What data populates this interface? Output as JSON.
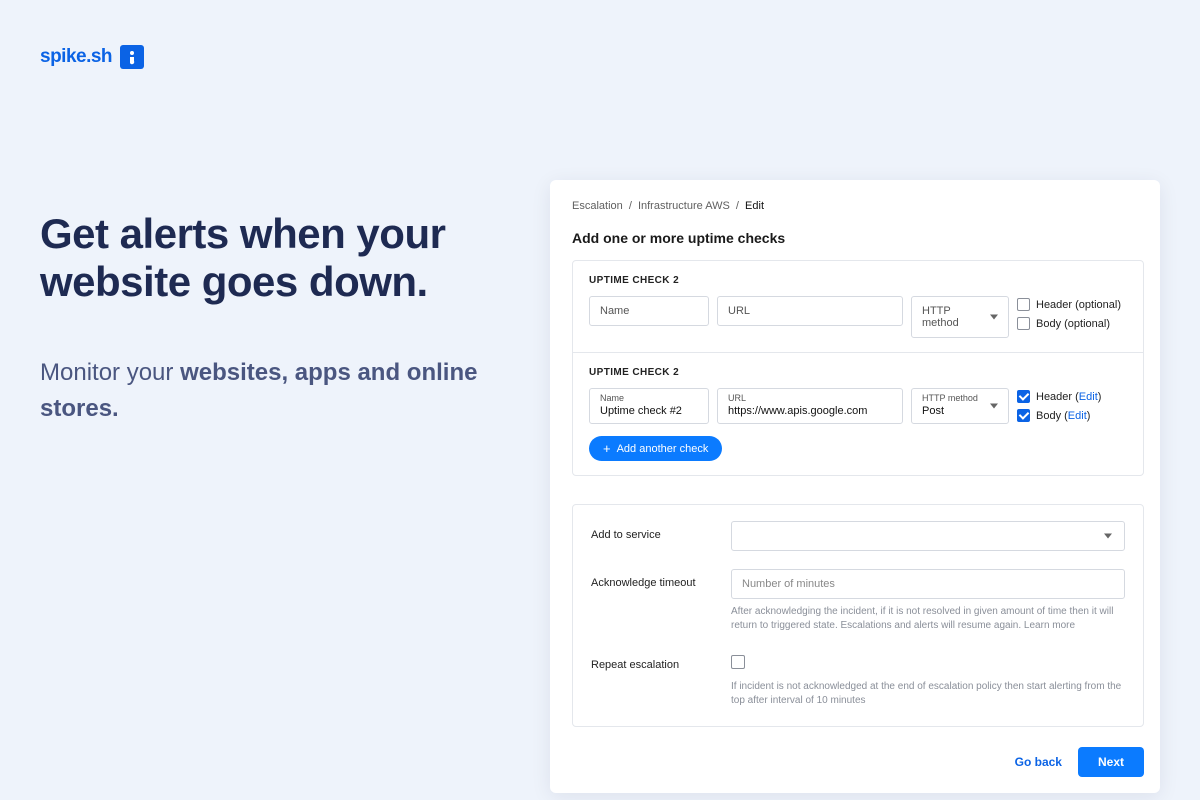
{
  "brand": {
    "name": "spike.sh"
  },
  "marketing": {
    "headline": "Get alerts when your website goes down.",
    "sub_prefix": "Monitor your ",
    "sub_bold": "websites, apps and online stores."
  },
  "breadcrumb": {
    "a": "Escalation",
    "b": "Infrastructure AWS",
    "c": "Edit"
  },
  "page": {
    "title": "Add one or more uptime checks"
  },
  "check1": {
    "heading": "UPTIME CHECK 2",
    "name_ph": "Name",
    "url_ph": "URL",
    "method_ph": "HTTP method",
    "header_label": "Header (optional)",
    "body_label": "Body (optional)"
  },
  "check2": {
    "heading": "UPTIME CHECK 2",
    "name_label": "Name",
    "name_value": "Uptime check #2",
    "url_label": "URL",
    "url_value": "https://www.apis.google.com",
    "method_label": "HTTP method",
    "method_value": "Post",
    "header_label": "Header (",
    "header_edit": "Edit",
    "body_label": "Body (",
    "body_edit": "Edit",
    "close_paren": ")"
  },
  "buttons": {
    "add_another": "Add another check",
    "go_back": "Go back",
    "next": "Next"
  },
  "form": {
    "service_label": "Add to service",
    "ack_label": "Acknowledge timeout",
    "ack_ph": "Number of minutes",
    "ack_help": "After acknowledging the incident, if it is not resolved in given amount of time then it will return to triggered state. Escalations and alerts will resume again. Learn more",
    "repeat_label": "Repeat escalation",
    "repeat_help": "If incident is not acknowledged at the end of escalation policy then start alerting from the top after interval of 10 minutes"
  }
}
